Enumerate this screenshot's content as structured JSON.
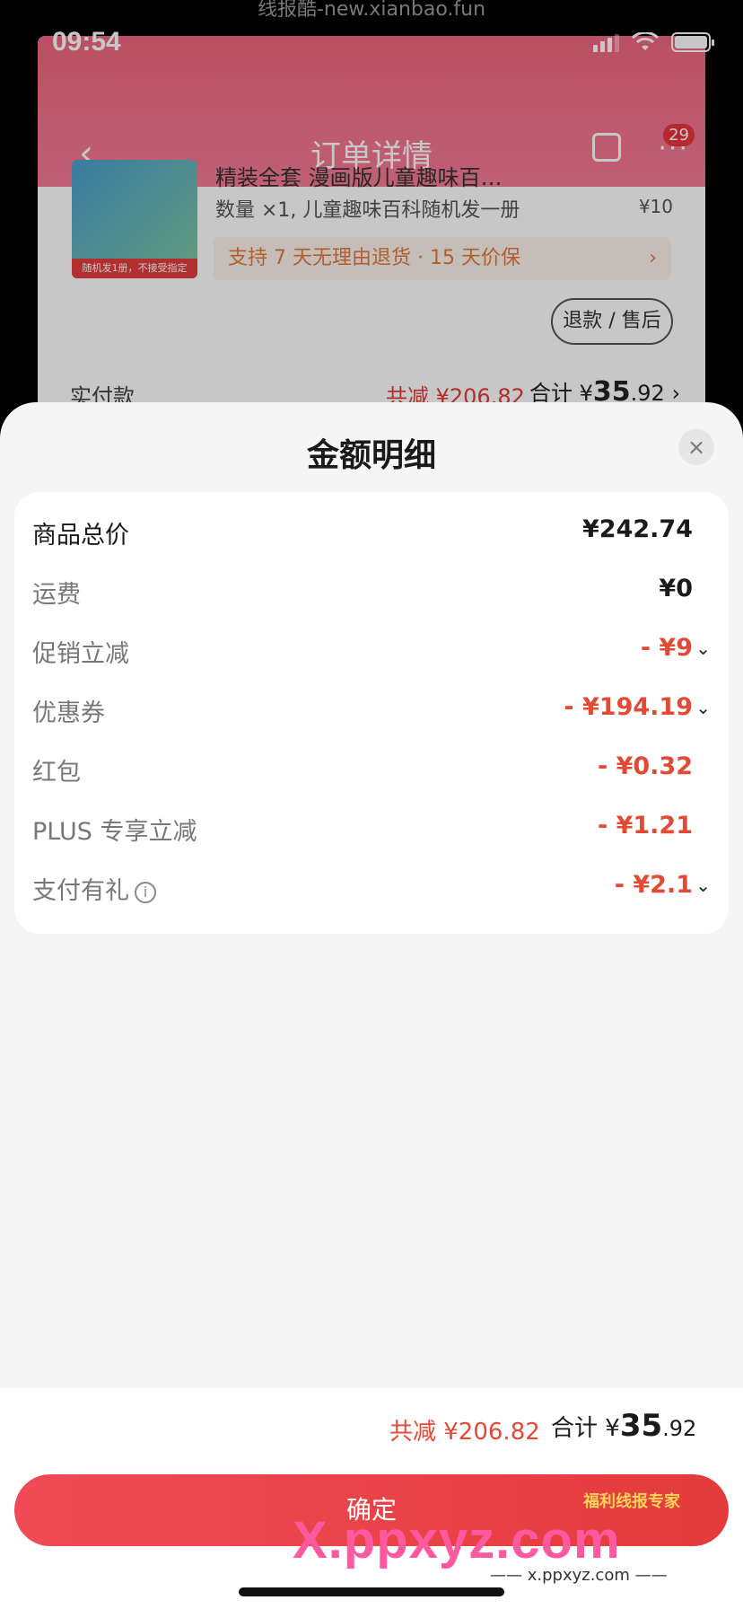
{
  "watermark_top": "线报酷-new.xianbao.fun",
  "status_bar": {
    "time": "09:54"
  },
  "nav": {
    "back": "‹",
    "title": "订单详情",
    "more": "···",
    "badge": "29"
  },
  "product": {
    "image_tag": "随机发1册，不接受指定",
    "name": "精装全套 漫画版儿童趣味百…",
    "quantity_text": "数量 ×1, 儿童趣味百科随机发一册",
    "price": "¥10",
    "promo_text": "支持 7 天无理由退货 · 15 天价保",
    "promo_arrow": "›",
    "refund_button": "退款 / 售后"
  },
  "paid": {
    "label": "实付款",
    "reduce": "共减 ¥206.82",
    "total_prefix": "合计 ¥",
    "total_int": "35",
    "total_dec": ".92",
    "arrow": "›"
  },
  "sheet": {
    "title": "金额明细",
    "close": "×",
    "rows": [
      {
        "label": "商品总价",
        "value": "¥242.74"
      },
      {
        "label": "运费",
        "value": "¥0"
      },
      {
        "label": "促销立减",
        "value": "- ¥9"
      },
      {
        "label": "优惠券",
        "value": "- ¥194.19"
      },
      {
        "label": "红包",
        "value": "- ¥0.32"
      },
      {
        "label": "PLUS 专享立减",
        "value": "- ¥1.21"
      },
      {
        "label": "支付有礼",
        "value": "- ¥2.1"
      }
    ],
    "chevron": "⌄",
    "info": "i"
  },
  "footer": {
    "reduce": "共减 ¥206.82",
    "total_prefix": "合计 ¥",
    "total_int": "35",
    "total_dec": ".92"
  },
  "confirm_button": "确定",
  "watermark_bottom": {
    "logo": "X.ppxyz.com",
    "url": "—— x.ppxyz.com ——",
    "badge": "福利线报专家"
  },
  "colors": {
    "accent_red": "#e24a36",
    "header_pink": "#e93b5a",
    "button_red": "#e43b3b"
  }
}
